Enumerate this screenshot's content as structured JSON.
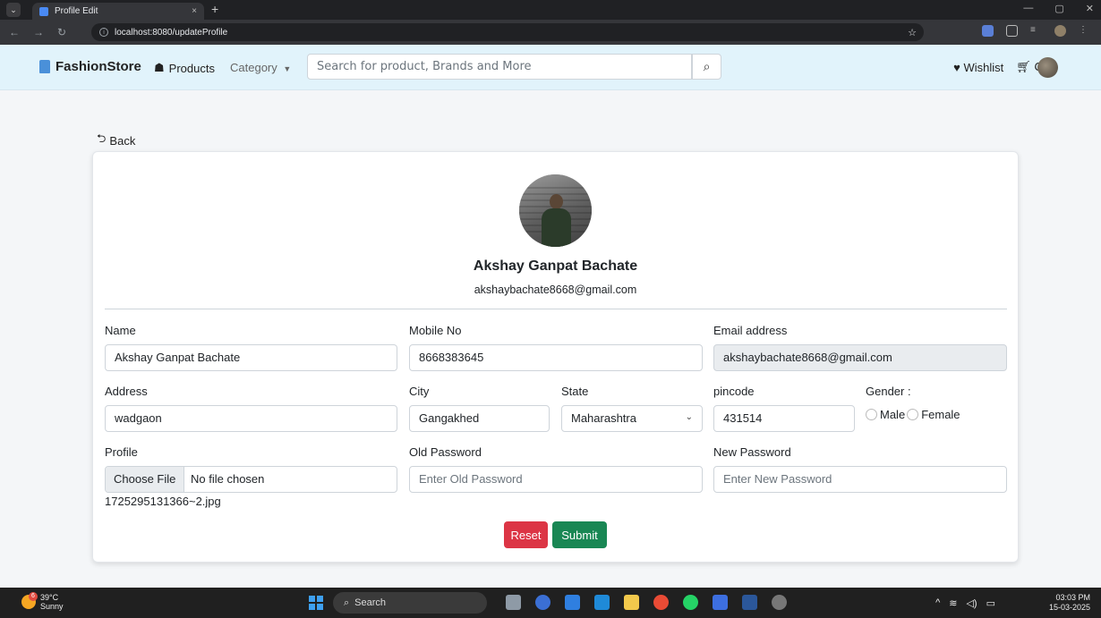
{
  "browser": {
    "tab_title": "Profile Edit",
    "tab_close": "×",
    "new_tab": "+",
    "url": "localhost:8080/updateProfile"
  },
  "navbar": {
    "brand": "FashionStore",
    "products": "Products",
    "category": "Category",
    "search_placeholder": "Search for product, Brands and More",
    "wishlist": "Wishlist",
    "cart": "Cart"
  },
  "page": {
    "back": "Back"
  },
  "profile": {
    "name": "Akshay Ganpat Bachate",
    "email": "akshaybachate8668@gmail.com"
  },
  "form": {
    "name_label": "Name",
    "name_value": "Akshay Ganpat Bachate",
    "mobile_label": "Mobile No",
    "mobile_value": "8668383645",
    "email_label": "Email address",
    "email_value": "akshaybachate8668@gmail.com",
    "address_label": "Address",
    "address_value": "wadgaon",
    "city_label": "City",
    "city_value": "Gangakhed",
    "state_label": "State",
    "state_value": "Maharashtra",
    "pincode_label": "pincode",
    "pincode_value": "431514",
    "gender_label": "Gender :",
    "gender_male": "Male",
    "gender_female": "Female",
    "profile_label": "Profile",
    "file_button": "Choose File",
    "file_status": "No file chosen",
    "current_file": "1725295131366~2.jpg",
    "old_password_label": "Old Password",
    "old_password_placeholder": "Enter Old Password",
    "new_password_label": "New Password",
    "new_password_placeholder": "Enter New Password",
    "reset": "Reset",
    "submit": "Submit"
  },
  "taskbar": {
    "temp": "39°C",
    "weather": "Sunny",
    "weather_badge": "6",
    "search": "Search",
    "time": "03:03 PM",
    "date": "15-03-2025"
  },
  "colors": {
    "navbar_bg": "#e1f3fb",
    "reset": "#dc3545",
    "submit": "#198754"
  }
}
